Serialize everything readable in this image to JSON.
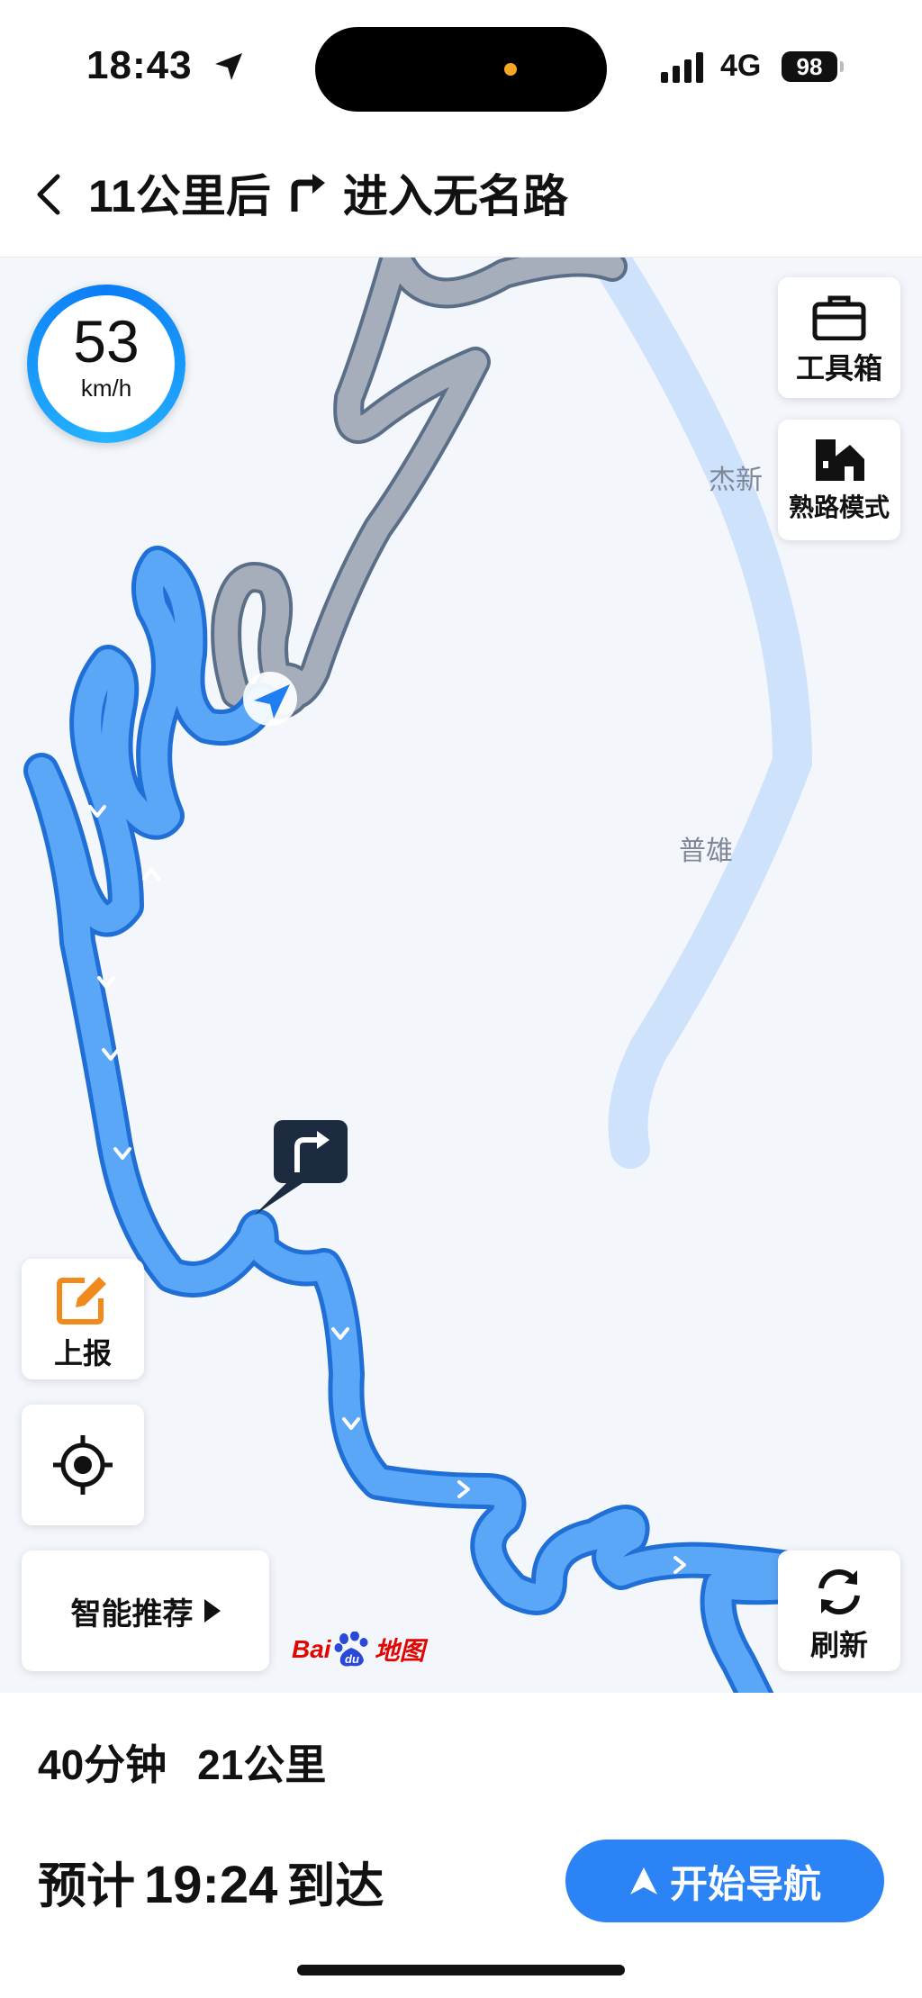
{
  "status_bar": {
    "time": "18:43",
    "network": "4G",
    "battery": "98"
  },
  "nav": {
    "distance_text": "11公里后",
    "action_text": "进入无名路",
    "turn_icon": "turn-right-icon"
  },
  "map": {
    "speed": {
      "value": "53",
      "unit": "km/h"
    },
    "labels": {
      "jiexin": "杰新",
      "puxiong": "普雄"
    },
    "toolbox_label": "工具箱",
    "familiar_mode_label": "熟路模式",
    "report_label": "上报",
    "smart_recommend_label": "智能推荐",
    "refresh_label": "刷新",
    "logo": {
      "bai": "Bai",
      "du": "du",
      "map": "地图"
    },
    "colors": {
      "route": "#5aa6f7",
      "route_edge": "#1f6fd6",
      "travelled": "#a6aebb",
      "river": "#cfe2fb"
    }
  },
  "trip": {
    "duration": "40分钟",
    "distance": "21公里",
    "eta_prefix": "预计",
    "eta_time": "19:24",
    "eta_suffix": "到达",
    "start_label": "开始导航"
  }
}
